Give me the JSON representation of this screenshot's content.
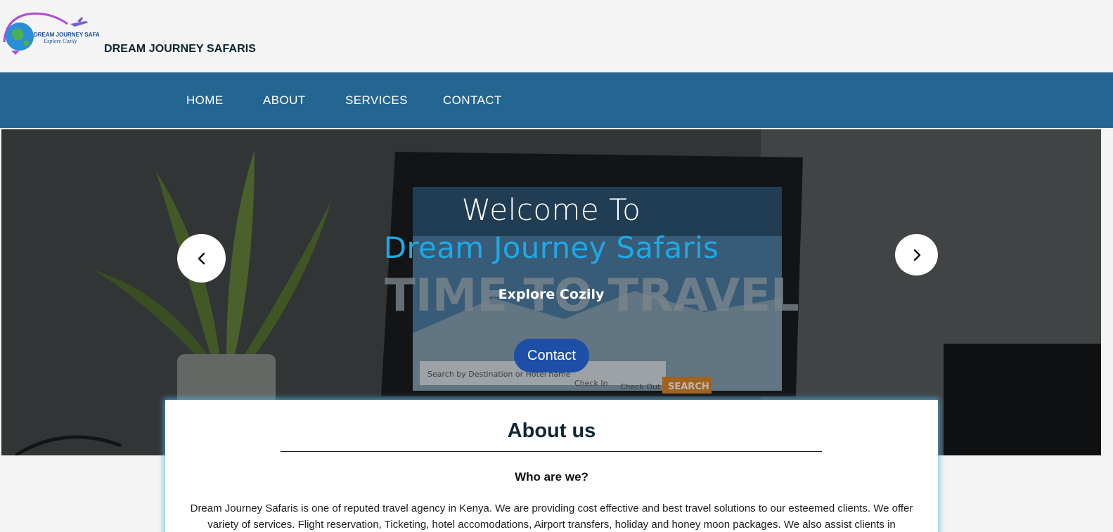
{
  "header": {
    "logo": {
      "brand_text": "DREAM JOURNEY SAFARIS",
      "tagline_text": "Explore Cozily",
      "colors": {
        "globe": "#2a8fd6",
        "land": "#4caf50",
        "ring": "#b04bd8",
        "plane": "#7a5be0"
      }
    },
    "site_name": "DREAM JOURNEY SAFARIS"
  },
  "nav": {
    "background": "#256591",
    "items": [
      "HOME",
      "ABOUT",
      "SERVICES",
      "CONTACT"
    ]
  },
  "hero": {
    "title": "Welcome To",
    "brand": "Dream Journey Safaris",
    "tagline": "Explore Cozily",
    "cta_label": "Contact",
    "prev_icon": "chevron-left-icon",
    "next_icon": "chevron-right-icon",
    "background_image": {
      "screen_headline": "TIME TO TRAVEL",
      "search_placeholder": "Search by Destination or Hotel name",
      "check_in": "Check In",
      "check_out": "Check Out",
      "search_button": "SEARCH"
    },
    "colors": {
      "brand": "#1ea8e6",
      "cta": "#1e4fa7"
    }
  },
  "about": {
    "title": "About us",
    "subtitle": "Who are we?",
    "body": "Dream Journey Safaris is one of reputed travel agency in Kenya. We are providing cost effective and best travel solutions to our esteemed clients. We offer variety of services. Flight reservation, Ticketing, hotel accomodations, Airport transfers, holiday and honey moon packages. We also assist clients in"
  }
}
